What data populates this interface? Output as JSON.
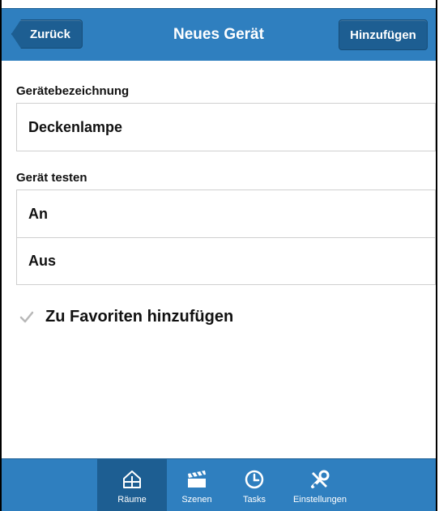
{
  "header": {
    "back_label": "Zurück",
    "title": "Neues Gerät",
    "add_label": "Hinzufügen"
  },
  "name_section": {
    "label": "Gerätebezeichnung",
    "value": "Deckenlampe"
  },
  "test_section": {
    "label": "Gerät testen",
    "options": [
      "An",
      "Aus"
    ]
  },
  "favorite": {
    "label": "Zu Favoriten hinzufügen",
    "checked": true
  },
  "tabbar": {
    "active": "Räume",
    "tabs": [
      {
        "label": "Räume",
        "icon": "house-icon"
      },
      {
        "label": "Szenen",
        "icon": "clapperboard-icon"
      },
      {
        "label": "Tasks",
        "icon": "clock-icon"
      },
      {
        "label": "Einstellungen",
        "icon": "tools-icon"
      }
    ]
  },
  "colors": {
    "bar": "#2f7fbf",
    "button": "#1d5e92",
    "border": "#cfcfcf"
  }
}
